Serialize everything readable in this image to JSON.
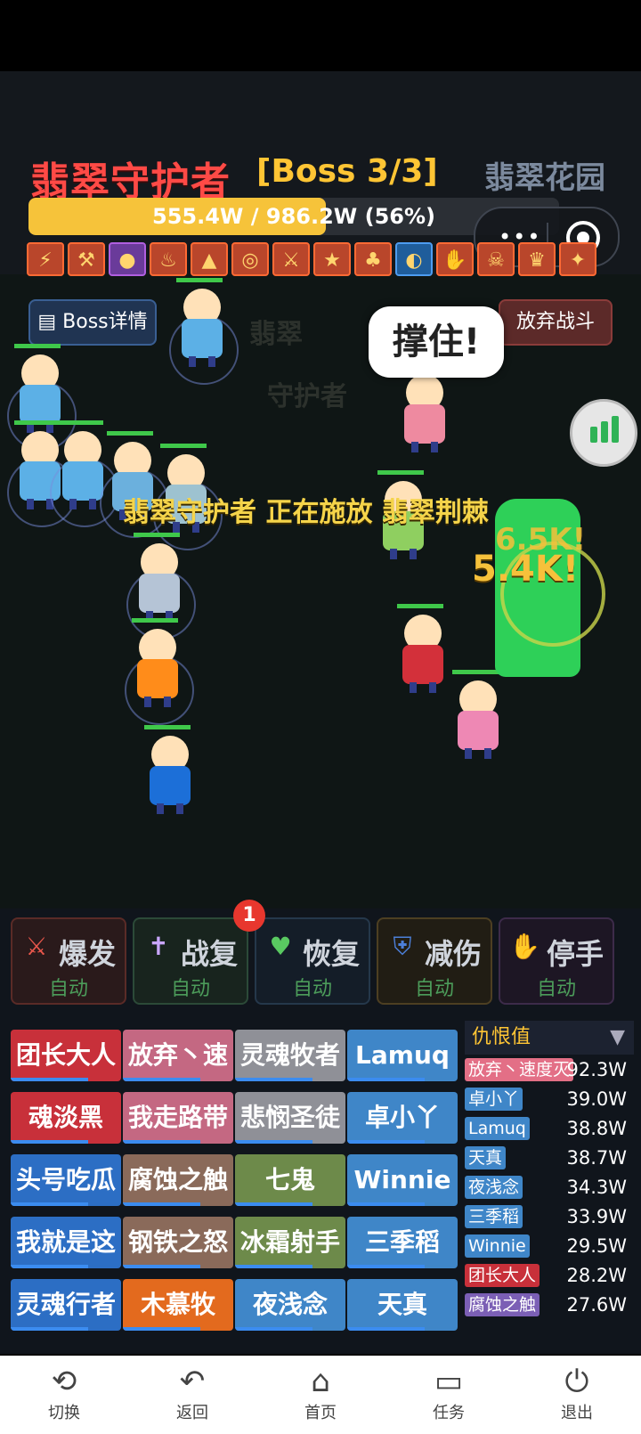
{
  "hud": {
    "boss_name": "翡翠守护者",
    "boss_count": "[Boss 3/3]",
    "zone": "翡翠花园",
    "hp_text": "555.4W / 986.2W (56%)",
    "hp_fraction": 0.56
  },
  "buttons": {
    "boss_detail": "Boss详情",
    "quit_battle": "放弃战斗"
  },
  "battle": {
    "speech": "撑住!",
    "cast_text": "翡翠守护者 正在施放 翡翠荆棘",
    "damage1": "6.5K!",
    "damage2": "5.4K!"
  },
  "skills": [
    {
      "name": "爆发",
      "mode": "自动",
      "icon": "crossed-swords-icon",
      "color": "#e9574c",
      "border": "#5a2b27",
      "bg": "#2a1a1b"
    },
    {
      "name": "战复",
      "mode": "自动",
      "icon": "cross-icon",
      "color": "#c9a6ff",
      "border": "#2c4a38",
      "bg": "#18241e"
    },
    {
      "name": "恢复",
      "mode": "自动",
      "icon": "heart-icon",
      "color": "#59c961",
      "border": "#25384b",
      "bg": "#141d28"
    },
    {
      "name": "减伤",
      "mode": "自动",
      "icon": "shield-icon",
      "color": "#4c7fd8",
      "border": "#4d3f22",
      "bg": "#211d14"
    },
    {
      "name": "停手",
      "mode": "自动",
      "icon": "hand-icon",
      "color": "#f0b24a",
      "border": "#3d2b4a",
      "bg": "#1d1624"
    }
  ],
  "skill_badge": "1",
  "members": [
    [
      "团长大人",
      "放弃丶速",
      "灵魂牧者",
      "Lamuq"
    ],
    [
      "魂淡黑",
      "我走路带",
      "悲悯圣徒",
      "卓小丫"
    ],
    [
      "头号吃瓜",
      "腐蚀之触",
      "七鬼",
      "Winnie"
    ],
    [
      "我就是这",
      "钢铁之怒",
      "冰霜射手",
      "三季稻"
    ],
    [
      "灵魂行者",
      "木慕牧",
      "夜浅念",
      "天真"
    ]
  ],
  "member_colors": [
    [
      "#c8303a",
      "#c46882",
      "#8f9097",
      "#3f86c8"
    ],
    [
      "#c8303a",
      "#c46882",
      "#8f9097",
      "#3f86c8"
    ],
    [
      "#2c6ec4",
      "#8a6a5a",
      "#6d8a4a",
      "#3f86c8"
    ],
    [
      "#2c6ec4",
      "#8a6a5a",
      "#6d8a4a",
      "#3f86c8"
    ],
    [
      "#2c6ec4",
      "#e36a1e",
      "#3f86c8",
      "#3f86c8"
    ]
  ],
  "aggro": {
    "title": "仇恨值",
    "arrow": "▼",
    "rows": [
      {
        "name": "放弃丶速度灭",
        "value": "92.3W",
        "color": "#e36f86"
      },
      {
        "name": "卓小丫",
        "value": "39.0W",
        "color": "#3f86c8"
      },
      {
        "name": "Lamuq",
        "value": "38.8W",
        "color": "#3f86c8"
      },
      {
        "name": "天真",
        "value": "38.7W",
        "color": "#3f86c8"
      },
      {
        "name": "夜浅念",
        "value": "34.3W",
        "color": "#3f86c8"
      },
      {
        "name": "三季稻",
        "value": "33.9W",
        "color": "#3f86c8"
      },
      {
        "name": "Winnie",
        "value": "29.5W",
        "color": "#3f86c8"
      },
      {
        "name": "团长大人",
        "value": "28.2W",
        "color": "#c8303a"
      },
      {
        "name": "腐蚀之触",
        "value": "27.6W",
        "color": "#7b5fb5"
      }
    ]
  },
  "nav": [
    {
      "label": "切换",
      "icon": "switch-icon"
    },
    {
      "label": "返回",
      "icon": "back-icon"
    },
    {
      "label": "首页",
      "icon": "home-icon"
    },
    {
      "label": "任务",
      "icon": "task-icon"
    },
    {
      "label": "退出",
      "icon": "exit-icon"
    }
  ]
}
